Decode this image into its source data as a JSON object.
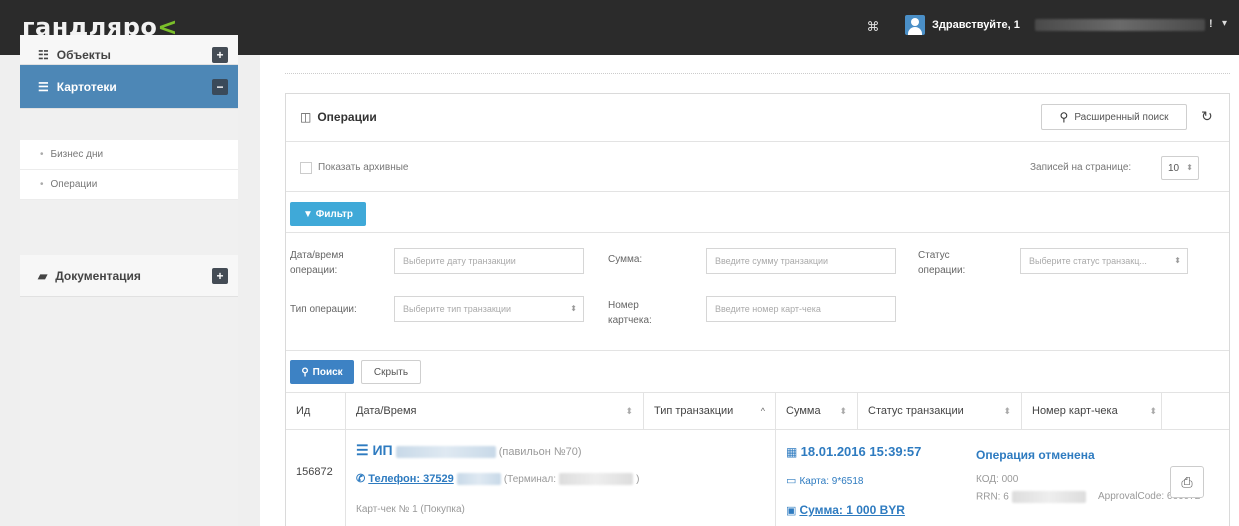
{
  "header": {
    "logo_main": "гандляро",
    "logo_accent": "<",
    "greeting": "Здравствуйте, 1",
    "user_suffix": "!",
    "caret": "▾"
  },
  "sidebar": {
    "cut_item": "Объекты",
    "active_item": "Картотеки",
    "sub_items": [
      "Бизнес дни",
      "Операции"
    ],
    "docs_item": "Документация"
  },
  "panel": {
    "title": "Операции",
    "advanced_search": "Расширенный поиск",
    "show_archived": "Показать архивные",
    "per_page_label": "Записей на странице:",
    "per_page_value": "10",
    "filter_button": "Фильтр",
    "search_button": "Поиск",
    "hide_button": "Скрыть"
  },
  "filters": {
    "datetime_label": "Дата/время операции:",
    "datetime_placeholder": "Выберите дату транзакции",
    "amount_label": "Сумма:",
    "amount_placeholder": "Введите сумму транзакции",
    "status_label": "Статус операции:",
    "status_placeholder": "Выберите статус транзакц...",
    "type_label": "Тип операции:",
    "type_placeholder": "Выберите тип транзакции",
    "receipt_label": "Номер картчека:",
    "receipt_placeholder": "Введите номер карт-чека"
  },
  "table": {
    "columns": [
      "Ид",
      "Дата/Время",
      "Тип транзакции",
      "Сумма",
      "Статус транзакции",
      "Номер карт-чека"
    ],
    "row": {
      "id": "156872",
      "merchant_prefix": "ИП",
      "pavilion": "(павильон №70)",
      "phone_label": "Телефон: 37529",
      "terminal_label": "(Терминал:",
      "receipt_line": "Карт-чек № 1 (Покупка)",
      "datetime": "18.01.2016 15:39:57",
      "card": "Карта: 9*6518",
      "amount": "Сумма: 1 000 BYR",
      "status": "Операция отменена",
      "code": "КОД: 000",
      "rrn": "RRN: 6",
      "approval": "ApprovalCode: 666072"
    }
  }
}
